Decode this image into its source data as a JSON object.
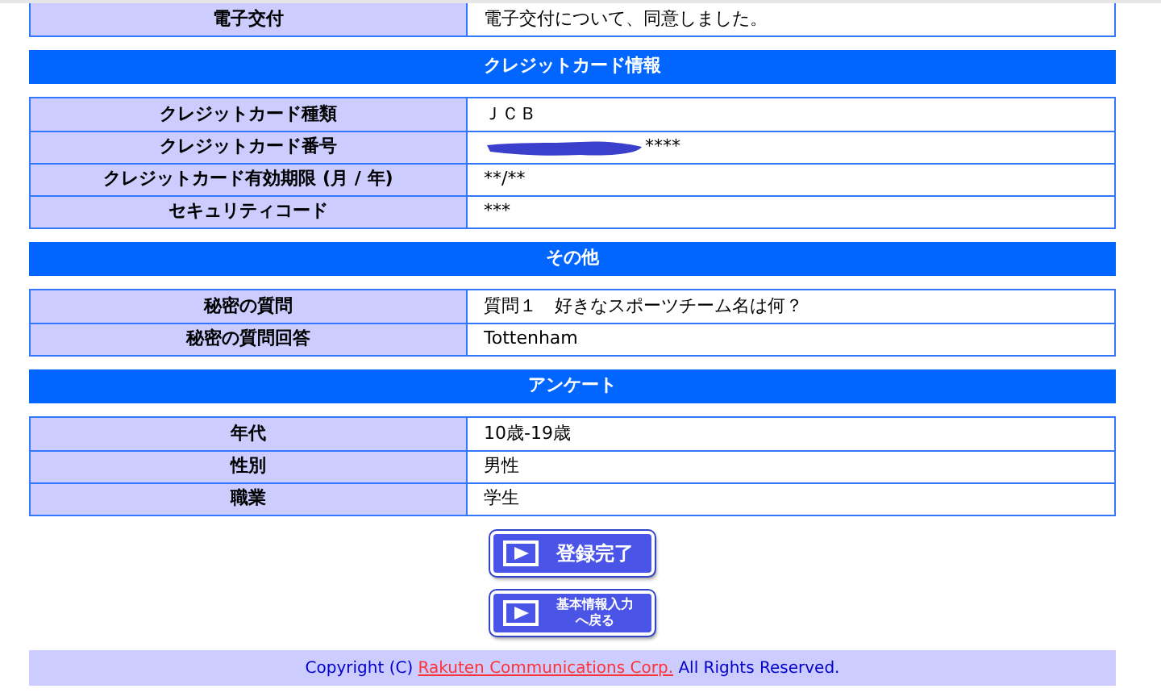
{
  "sections": [
    {
      "rows": [
        {
          "label": "電子交付",
          "value": "電子交付について、同意しました。"
        }
      ]
    },
    {
      "title": "クレジットカード情報",
      "rows": [
        {
          "label": "クレジットカード種類",
          "value": "ＪＣＢ"
        },
        {
          "label": "クレジットカード番号",
          "value": "****",
          "redacted": true
        },
        {
          "label": "クレジットカード有効期限 (月 / 年)",
          "value": "**/**"
        },
        {
          "label": "セキュリティコード",
          "value": "***"
        }
      ]
    },
    {
      "title": "その他",
      "rows": [
        {
          "label": "秘密の質問",
          "value": "質問１　好きなスポーツチーム名は何？"
        },
        {
          "label": "秘密の質問回答",
          "value": "Tottenham"
        }
      ]
    },
    {
      "title": "アンケート",
      "rows": [
        {
          "label": "年代",
          "value": "10歳-19歳"
        },
        {
          "label": "性別",
          "value": "男性"
        },
        {
          "label": "職業",
          "value": "学生"
        }
      ]
    }
  ],
  "buttons": [
    {
      "lines": [
        "登録完了"
      ],
      "kind": "large"
    },
    {
      "lines": [
        "基本情報入力",
        "へ戻る"
      ],
      "kind": "small"
    }
  ],
  "footer": {
    "before": "Copyright (C) ",
    "link": "Rakuten Communications Corp.",
    "after": " All Rights Reserved."
  }
}
